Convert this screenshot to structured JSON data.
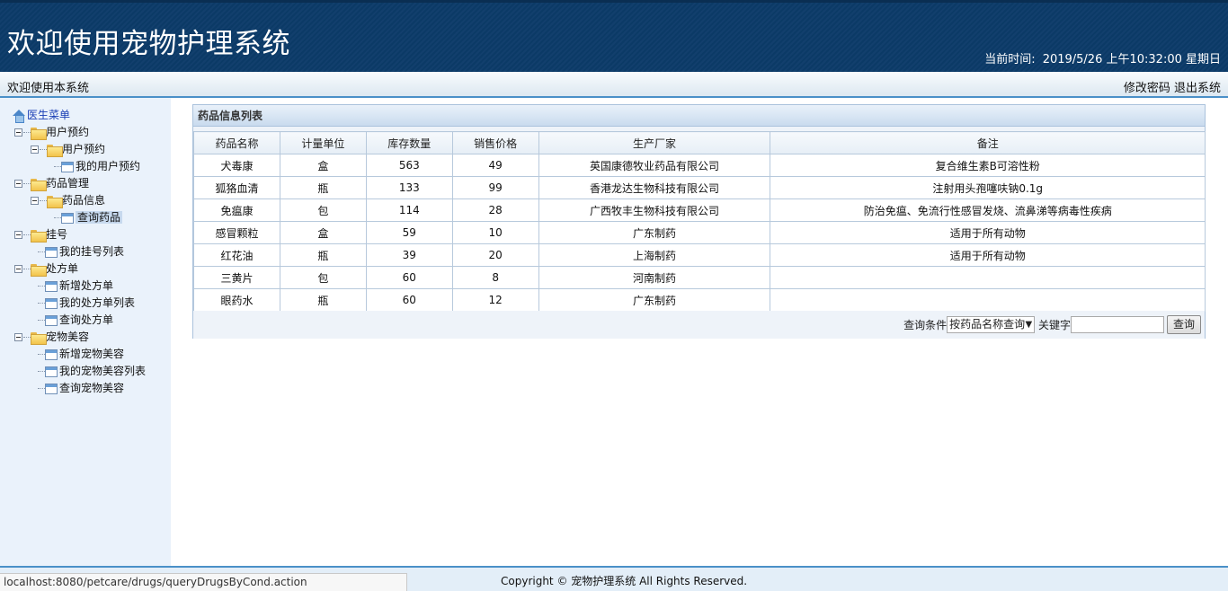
{
  "header": {
    "title": "欢迎使用宠物护理系统",
    "time_label": "当前时间:",
    "time_value": "2019/5/26 上午10:32:00 星期日"
  },
  "subbar": {
    "welcome": "欢迎使用本系统",
    "change_password": "修改密码",
    "logout": "退出系统"
  },
  "sidebar": {
    "root": "医生菜单",
    "groups": [
      {
        "label": "用户预约",
        "children": [
          {
            "label": "用户预约",
            "children": [
              {
                "label": "我的用户预约"
              }
            ]
          }
        ]
      },
      {
        "label": "药品管理",
        "children": [
          {
            "label": "药品信息",
            "children": [
              {
                "label": "查询药品"
              }
            ]
          }
        ]
      },
      {
        "label": "挂号",
        "children": [
          {
            "label": "我的挂号列表"
          }
        ]
      },
      {
        "label": "处方单",
        "children": [
          {
            "label": "新增处方单"
          },
          {
            "label": "我的处方单列表"
          },
          {
            "label": "查询处方单"
          }
        ]
      },
      {
        "label": "宠物美容",
        "children": [
          {
            "label": "新增宠物美容"
          },
          {
            "label": "我的宠物美容列表"
          },
          {
            "label": "查询宠物美容"
          }
        ]
      }
    ]
  },
  "panel": {
    "title": "药品信息列表",
    "columns": [
      "药品名称",
      "计量单位",
      "库存数量",
      "销售价格",
      "生产厂家",
      "备注"
    ],
    "rows": [
      [
        "犬毒康",
        "盒",
        "563",
        "49",
        "英国康德牧业药品有限公司",
        "复合维生素B可溶性粉"
      ],
      [
        "狐狢血清",
        "瓶",
        "133",
        "99",
        "香港龙达生物科技有限公司",
        "注射用头孢噻呋钠0.1g"
      ],
      [
        "免瘟康",
        "包",
        "114",
        "28",
        "广西牧丰生物科技有限公司",
        "防治免瘟、免流行性感冒发烧、流鼻涕等病毒性疾病"
      ],
      [
        "感冒颗粒",
        "盒",
        "59",
        "10",
        "广东制药",
        "适用于所有动物"
      ],
      [
        "红花油",
        "瓶",
        "39",
        "20",
        "上海制药",
        "适用于所有动物"
      ],
      [
        "三黄片",
        "包",
        "60",
        "8",
        "河南制药",
        ""
      ],
      [
        "眼药水",
        "瓶",
        "60",
        "12",
        "广东制药",
        ""
      ]
    ],
    "query": {
      "condition_label": "查询条件",
      "condition_value": "按药品名称查询",
      "keyword_label": "关键字",
      "keyword_value": "",
      "button": "查询"
    }
  },
  "footer": {
    "copyright": "Copyright © 宠物护理系统 All Rights Reserved.",
    "status_url": "localhost:8080/petcare/drugs/queryDrugsByCond.action"
  }
}
